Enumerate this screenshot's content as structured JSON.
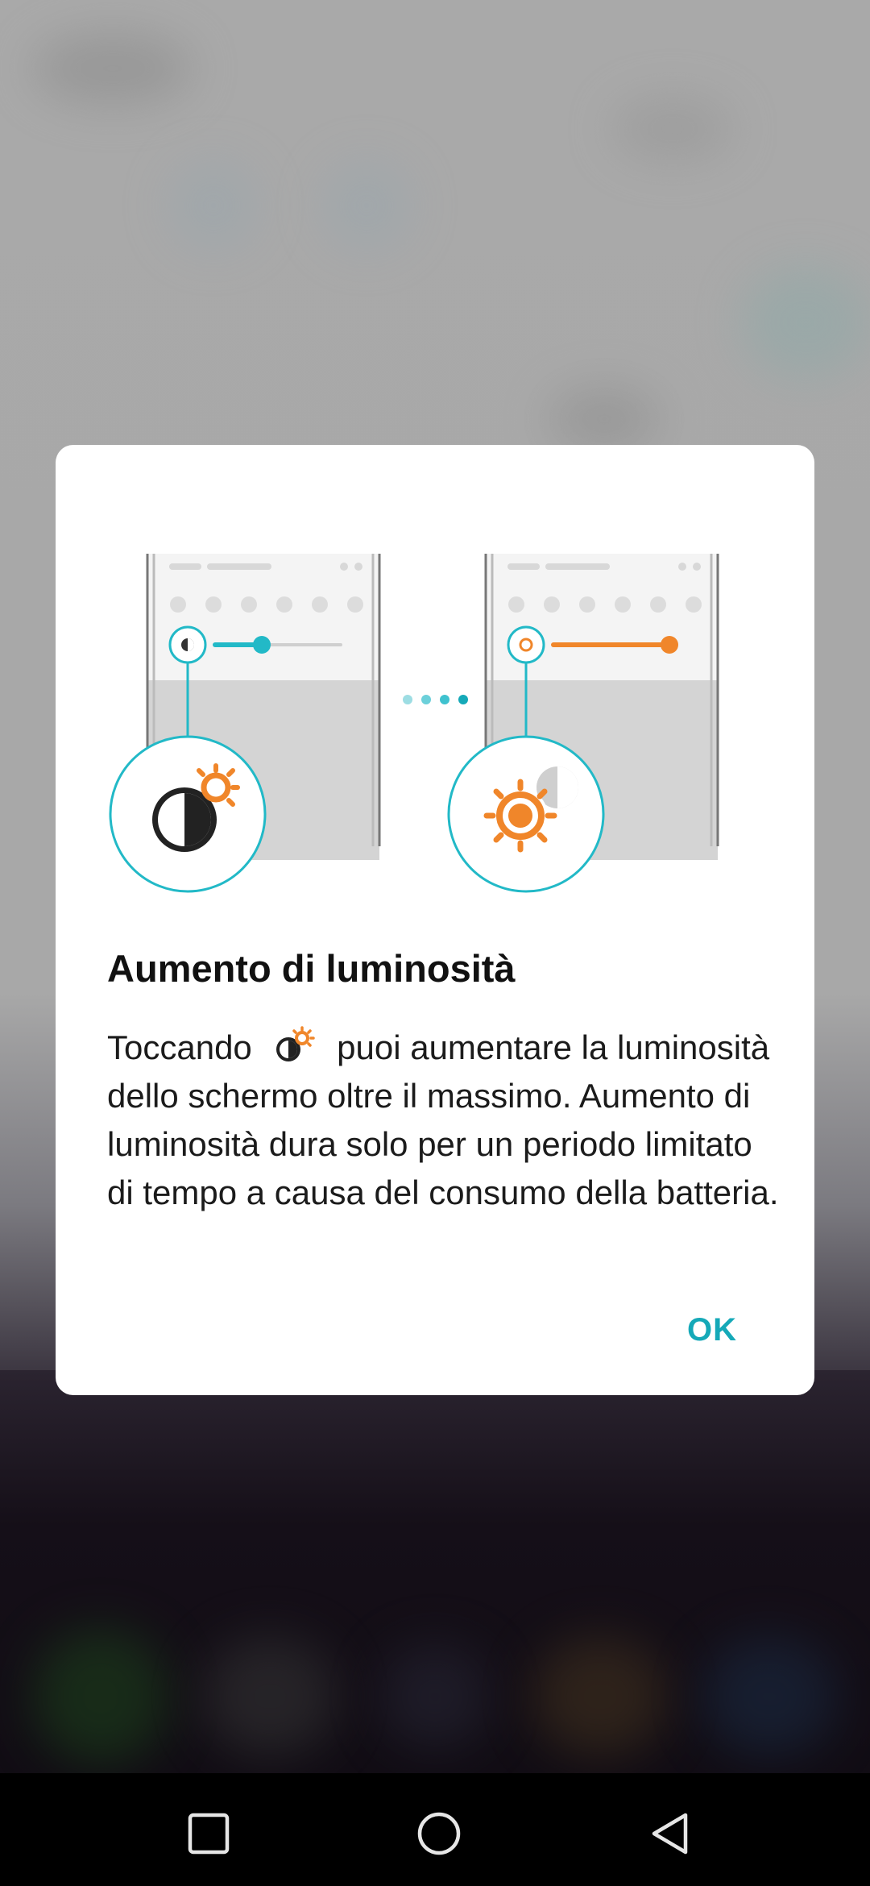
{
  "dialog": {
    "title": "Aumento di luminosità",
    "body_before_icon": "Toccando ",
    "body_after_icon": " puoi aumentare la luminosità dello schermo oltre il massimo. Aumento di luminosità dura solo per un periodo limitato di tempo a causa del consumo della batteria.",
    "ok_label": "OK",
    "inline_icon": "brightness-boost-icon"
  },
  "navbar": {
    "recents_icon": "square-icon",
    "home_icon": "circle-icon",
    "back_icon": "triangle-back-icon"
  },
  "colors": {
    "accent": "#15a9b8",
    "orange": "#f0862a",
    "dialog_bg": "#ffffff"
  }
}
